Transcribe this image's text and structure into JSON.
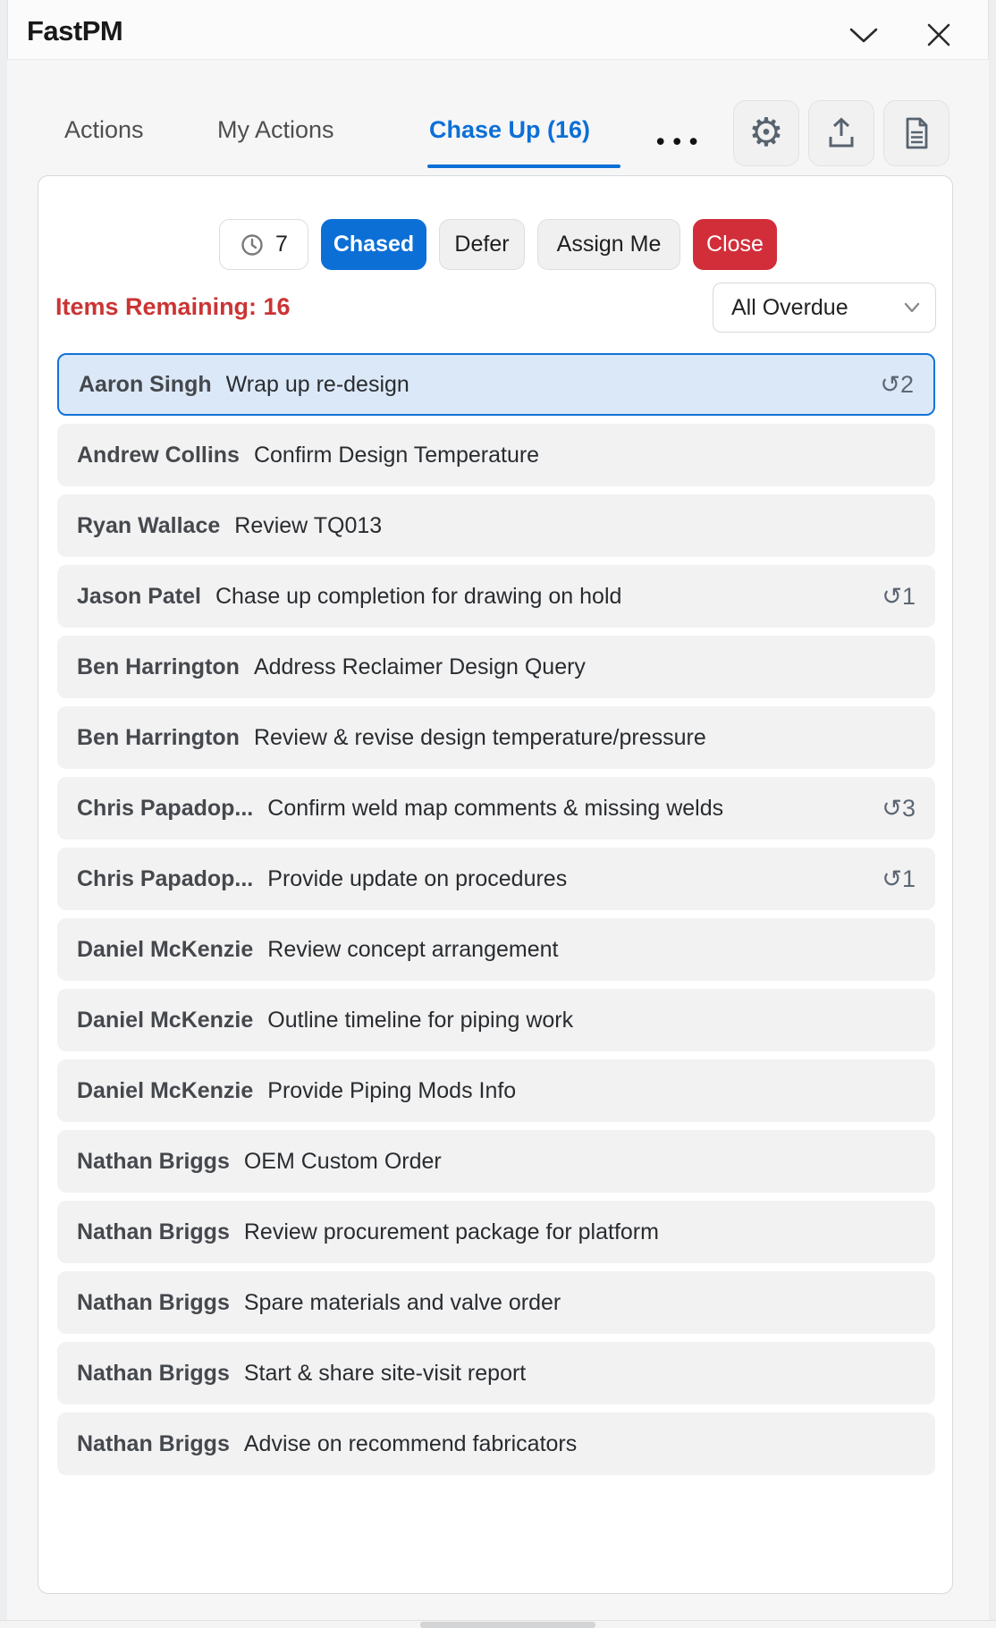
{
  "title_bar": {
    "app_title": "FastPM"
  },
  "tabs": [
    {
      "label": "Actions",
      "active": false
    },
    {
      "label": "My Actions",
      "active": false
    },
    {
      "label": "Chase Up (16)",
      "active": true
    }
  ],
  "toolbar": {
    "more_label": "•••",
    "icon_buttons": [
      "settings-gear",
      "share-export",
      "document-report"
    ]
  },
  "action_bar": {
    "chase_timer_count": "7",
    "chased_label": "Chased",
    "defer_label": "Defer",
    "assign_me_label": "Assign Me",
    "close_label": "Close"
  },
  "summary": {
    "items_remaining": "Items Remaining: 16",
    "filter_selected": "All Overdue"
  },
  "icons": {
    "chase_badge_glyph": "↺"
  },
  "colors": {
    "accent_blue": "#0c6fd6",
    "alert_red": "#cb3434",
    "close_red": "#d22e3a",
    "selected_row_bg": "#dbe8f8",
    "selected_row_border": "#1273d8",
    "row_bg": "#f2f2f3"
  },
  "list": {
    "items": [
      {
        "name": "Aaron Singh",
        "task": "Wrap up re-design",
        "chased_count": 2,
        "selected": true
      },
      {
        "name": "Andrew Collins",
        "task": "Confirm Design Temperature",
        "chased_count": null,
        "selected": false
      },
      {
        "name": "Ryan Wallace",
        "task": "Review TQ013",
        "chased_count": null,
        "selected": false
      },
      {
        "name": "Jason Patel",
        "task": "Chase up completion for drawing on hold",
        "chased_count": 1,
        "selected": false
      },
      {
        "name": "Ben Harrington",
        "task": "Address Reclaimer Design Query",
        "chased_count": null,
        "selected": false
      },
      {
        "name": "Ben Harrington",
        "task": "Review & revise design temperature/pressure",
        "chased_count": null,
        "selected": false
      },
      {
        "name": "Chris Papadop...",
        "task": "Confirm weld map comments & missing welds",
        "chased_count": 3,
        "selected": false
      },
      {
        "name": "Chris Papadop...",
        "task": "Provide update on procedures",
        "chased_count": 1,
        "selected": false
      },
      {
        "name": "Daniel McKenzie",
        "task": "Review concept arrangement",
        "chased_count": null,
        "selected": false
      },
      {
        "name": "Daniel McKenzie",
        "task": "Outline timeline for piping work",
        "chased_count": null,
        "selected": false
      },
      {
        "name": "Daniel McKenzie",
        "task": "Provide Piping Mods Info",
        "chased_count": null,
        "selected": false
      },
      {
        "name": "Nathan Briggs",
        "task": "OEM Custom Order",
        "chased_count": null,
        "selected": false
      },
      {
        "name": "Nathan Briggs",
        "task": "Review procurement package for platform",
        "chased_count": null,
        "selected": false
      },
      {
        "name": "Nathan Briggs",
        "task": "Spare materials and valve order",
        "chased_count": null,
        "selected": false
      },
      {
        "name": "Nathan Briggs",
        "task": "Start & share site-visit report",
        "chased_count": null,
        "selected": false
      },
      {
        "name": "Nathan Briggs",
        "task": "Advise on recommend fabricators",
        "chased_count": null,
        "selected": false
      }
    ]
  }
}
